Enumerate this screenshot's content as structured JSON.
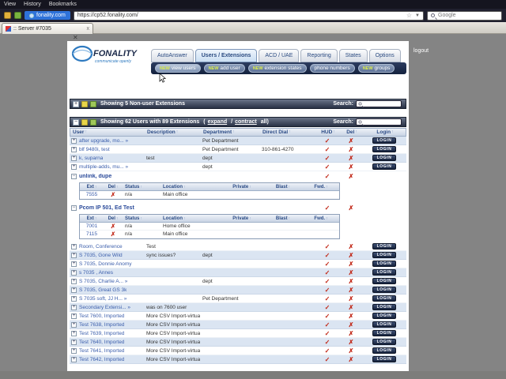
{
  "browser": {
    "menu_items": [
      "View",
      "History",
      "Bookmarks"
    ],
    "site_chip": "fonality.com",
    "url": "https://cp52.fonality.com/",
    "search_placeholder": "Google",
    "tab_title": ":: Server #7035",
    "tab_close": "x"
  },
  "logo": {
    "name": "FONALITY",
    "tagline": "communicate openly"
  },
  "logout_label": "logout",
  "nav_tabs": [
    {
      "label": "AutoAnswer",
      "active": false
    },
    {
      "label": "Users / Extensions",
      "active": true
    },
    {
      "label": "ACD / UAE",
      "active": false
    },
    {
      "label": "Reporting",
      "active": false
    },
    {
      "label": "States",
      "active": false
    },
    {
      "label": "Options",
      "active": false
    }
  ],
  "subnav": [
    {
      "label": "view users",
      "new": true,
      "active": true
    },
    {
      "label": "add user",
      "new": true,
      "active": false
    },
    {
      "label": "extension states",
      "new": true,
      "active": false
    },
    {
      "label": "phone numbers",
      "new": false,
      "active": false
    },
    {
      "label": "groups",
      "new": true,
      "active": false
    }
  ],
  "badge_new": "NEW",
  "sections": {
    "nonuser": {
      "title": "Showing 5 Non-user Extensions",
      "search_label": "Search:"
    },
    "users": {
      "title": "Showing 62 Users with 89 Extensions",
      "open_paren": "(",
      "expand_label": "expand",
      "slash": "/",
      "contract_label": "contract",
      "all_suffix": " all)",
      "search_label": "Search:"
    }
  },
  "table": {
    "headers": [
      "User",
      "Description",
      "Department",
      "Direct Dial",
      "HUD",
      "Del",
      "Login"
    ],
    "sub_headers": [
      "Ext",
      "Del",
      "Status",
      "Location",
      "Private",
      "Blast",
      "Fwd."
    ],
    "login_label": "LOGIN",
    "rows": [
      {
        "type": "user",
        "alt": true,
        "user": "after upgrade, mo... »",
        "desc": "",
        "dept": "Pet Department",
        "dial": ""
      },
      {
        "type": "user",
        "alt": false,
        "user": "blf 9480i, test",
        "desc": "",
        "dept": "Pet Department",
        "dial": "310-861-4270"
      },
      {
        "type": "user",
        "alt": true,
        "user": "k, suparna",
        "desc": "test",
        "dept": "dept",
        "dial": ""
      },
      {
        "type": "user",
        "alt": false,
        "user": "multiple-adds, mu... »",
        "desc": "",
        "dept": "dept",
        "dial": ""
      },
      {
        "type": "group",
        "user": "unlink, dupe"
      },
      {
        "type": "subtable",
        "rows": [
          {
            "ext": "7555",
            "status": "n/a",
            "location": "Main office",
            "private": "",
            "blast": "",
            "fwd": ""
          }
        ]
      },
      {
        "type": "group",
        "user": "Pcom IP 501, Ed Test"
      },
      {
        "type": "subtable",
        "rows": [
          {
            "ext": "7001",
            "status": "n/a",
            "location": "Home office",
            "private": "",
            "blast": "",
            "fwd": ""
          },
          {
            "ext": "7115",
            "status": "n/a",
            "location": "Main office",
            "private": "",
            "blast": "",
            "fwd": ""
          }
        ]
      },
      {
        "type": "user",
        "alt": false,
        "user": "Room, Conference",
        "desc": "Test",
        "dept": "",
        "dial": ""
      },
      {
        "type": "user",
        "alt": true,
        "user": "S 7035, Gone Wild",
        "desc": "sync issues?",
        "dept": "dept",
        "dial": ""
      },
      {
        "type": "user",
        "alt": false,
        "user": "S 7035, Donnie Anomy",
        "desc": "",
        "dept": "",
        "dial": ""
      },
      {
        "type": "user",
        "alt": true,
        "user": "s 7035 , Annes",
        "desc": "",
        "dept": "",
        "dial": ""
      },
      {
        "type": "user",
        "alt": false,
        "user": "S 7035, Charlie A... »",
        "desc": "",
        "dept": "dept",
        "dial": ""
      },
      {
        "type": "user",
        "alt": true,
        "user": "S 7035, Great GS 3k",
        "desc": "",
        "dept": "",
        "dial": ""
      },
      {
        "type": "user",
        "alt": false,
        "user": "S 7035 soft, JJ H... »",
        "desc": "",
        "dept": "Pet Department",
        "dial": ""
      },
      {
        "type": "user",
        "alt": true,
        "user": "Secondary Extensi... »",
        "desc": "was on 7600 user",
        "dept": "",
        "dial": ""
      },
      {
        "type": "user",
        "alt": false,
        "user": "Test 7600, Imported",
        "desc": "More CSV Import-virtual",
        "dept": "",
        "dial": ""
      },
      {
        "type": "user",
        "alt": true,
        "user": "Test 7638, Imported",
        "desc": "More CSV Import-virtual",
        "dept": "",
        "dial": ""
      },
      {
        "type": "user",
        "alt": false,
        "user": "Test 7639, Imported",
        "desc": "More CSV Import-virtual",
        "dept": "",
        "dial": ""
      },
      {
        "type": "user",
        "alt": true,
        "user": "Test 7640, Imported",
        "desc": "More CSV Import-virtual",
        "dept": "",
        "dial": ""
      },
      {
        "type": "user",
        "alt": false,
        "user": "Test 7641, Imported",
        "desc": "More CSV Import-virtual",
        "dept": "",
        "dial": ""
      },
      {
        "type": "user",
        "alt": true,
        "user": "Test 7642, Imported",
        "desc": "More CSV Import-virtual",
        "dept": "",
        "dial": ""
      }
    ]
  },
  "colors": {
    "accent_blue": "#2e72d9",
    "status_red": "#c22a1a",
    "link_blue": "#3a5dab",
    "bar_navy": "#283145"
  }
}
